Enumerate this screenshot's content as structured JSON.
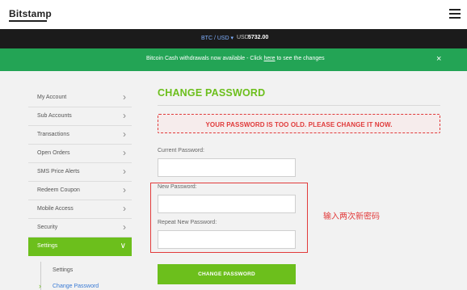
{
  "header": {
    "logo": "Bitstamp",
    "menu_icon": "hamburger-icon"
  },
  "ticker": {
    "pair": "BTC / USD ▾",
    "price_label": "USD",
    "price_value": "5732.00"
  },
  "banner": {
    "text_before": "Bitcoin Cash withdrawals now available - Click ",
    "link": "here",
    "text_after": " to see the changes",
    "close": "×",
    "color": "#23a455"
  },
  "sidebar": {
    "items": [
      {
        "label": "My Account"
      },
      {
        "label": "Sub Accounts"
      },
      {
        "label": "Transactions"
      },
      {
        "label": "Open Orders"
      },
      {
        "label": "SMS Price Alerts"
      },
      {
        "label": "Redeem Coupon"
      },
      {
        "label": "Mobile Access"
      },
      {
        "label": "Security"
      },
      {
        "label": "Settings"
      }
    ],
    "active_index": 8,
    "submenu": [
      {
        "label": "Settings"
      },
      {
        "label": "Change Password"
      }
    ]
  },
  "main": {
    "title": "CHANGE PASSWORD",
    "alert": "YOUR PASSWORD IS TOO OLD. PLEASE CHANGE IT NOW.",
    "fields": {
      "current_password": {
        "label": "Current Password:",
        "value": ""
      },
      "new_password": {
        "label": "New Password:",
        "value": ""
      },
      "repeat_password": {
        "label": "Repeat New Password:",
        "value": ""
      }
    },
    "submit_label": "CHANGE PASSWORD",
    "accent_color": "#6cbf1c"
  },
  "annotation": {
    "text": "输入两次新密码",
    "color": "#e23b3b"
  }
}
